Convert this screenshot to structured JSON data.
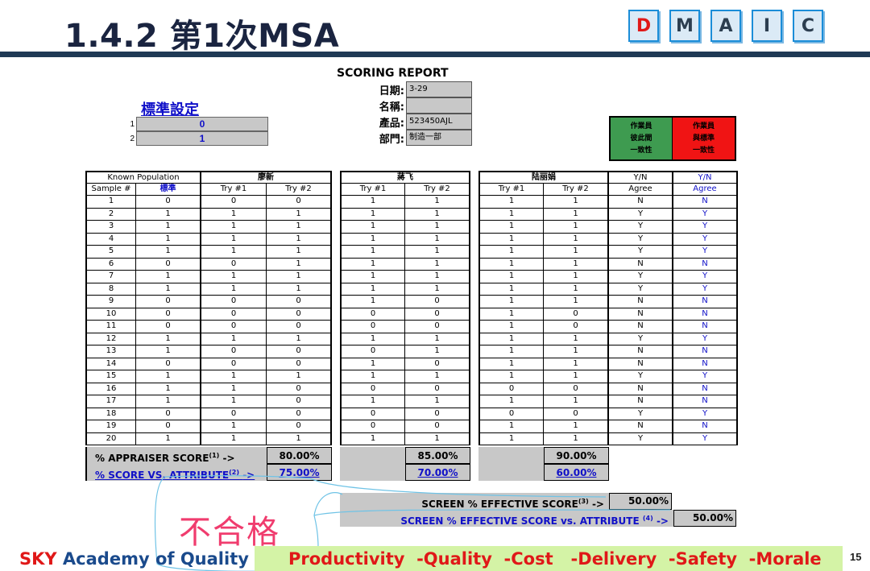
{
  "slide": {
    "title": "1.4.2 第1次MSA",
    "dmaic": [
      {
        "letter": "D",
        "active": true
      },
      {
        "letter": "M",
        "active": false
      },
      {
        "letter": "A",
        "active": false
      },
      {
        "letter": "I",
        "active": false
      },
      {
        "letter": "C",
        "active": false
      }
    ],
    "page_number": "15"
  },
  "report": {
    "title": "SCORING REPORT",
    "info": [
      {
        "label": "日期:",
        "value": "3-29"
      },
      {
        "label": "名稱:",
        "value": ""
      },
      {
        "label": "產品:",
        "value": "523450AJL"
      },
      {
        "label": "部門:",
        "value": "制造一部"
      }
    ]
  },
  "standard": {
    "heading": "標準設定",
    "rows": [
      {
        "index": "1",
        "value": "0"
      },
      {
        "index": "2",
        "value": "1"
      }
    ]
  },
  "legend": {
    "agree_lines": [
      "作業員",
      "彼此間",
      "一致性"
    ],
    "attr_lines": [
      "作業員",
      "與標準",
      "一致性"
    ],
    "agree_color": "#3e9b50",
    "attr_color": "#f01414"
  },
  "table": {
    "group_headers": [
      "Known Population",
      "廖新",
      "蔣飞",
      "陆丽娟",
      "Y/N",
      "Y/N"
    ],
    "sub_headers": [
      "Sample #",
      "標準",
      "Try #1",
      "Try #2",
      "Try #1",
      "Try #2",
      "Try #1",
      "Try #2",
      "Agree",
      "Agree"
    ],
    "rows": [
      [
        "1",
        "0",
        "0",
        "0",
        "1",
        "1",
        "1",
        "1",
        "N",
        "N"
      ],
      [
        "2",
        "1",
        "1",
        "1",
        "1",
        "1",
        "1",
        "1",
        "Y",
        "Y"
      ],
      [
        "3",
        "1",
        "1",
        "1",
        "1",
        "1",
        "1",
        "1",
        "Y",
        "Y"
      ],
      [
        "4",
        "1",
        "1",
        "1",
        "1",
        "1",
        "1",
        "1",
        "Y",
        "Y"
      ],
      [
        "5",
        "1",
        "1",
        "1",
        "1",
        "1",
        "1",
        "1",
        "Y",
        "Y"
      ],
      [
        "6",
        "0",
        "0",
        "1",
        "1",
        "1",
        "1",
        "1",
        "N",
        "N"
      ],
      [
        "7",
        "1",
        "1",
        "1",
        "1",
        "1",
        "1",
        "1",
        "Y",
        "Y"
      ],
      [
        "8",
        "1",
        "1",
        "1",
        "1",
        "1",
        "1",
        "1",
        "Y",
        "Y"
      ],
      [
        "9",
        "0",
        "0",
        "0",
        "1",
        "0",
        "1",
        "1",
        "N",
        "N"
      ],
      [
        "10",
        "0",
        "0",
        "0",
        "0",
        "0",
        "1",
        "0",
        "N",
        "N"
      ],
      [
        "11",
        "0",
        "0",
        "0",
        "0",
        "0",
        "1",
        "0",
        "N",
        "N"
      ],
      [
        "12",
        "1",
        "1",
        "1",
        "1",
        "1",
        "1",
        "1",
        "Y",
        "Y"
      ],
      [
        "13",
        "1",
        "0",
        "0",
        "0",
        "1",
        "1",
        "1",
        "N",
        "N"
      ],
      [
        "14",
        "0",
        "0",
        "0",
        "1",
        "0",
        "1",
        "1",
        "N",
        "N"
      ],
      [
        "15",
        "1",
        "1",
        "1",
        "1",
        "1",
        "1",
        "1",
        "Y",
        "Y"
      ],
      [
        "16",
        "1",
        "1",
        "0",
        "0",
        "0",
        "0",
        "0",
        "N",
        "N"
      ],
      [
        "17",
        "1",
        "1",
        "0",
        "1",
        "1",
        "1",
        "1",
        "N",
        "N"
      ],
      [
        "18",
        "0",
        "0",
        "0",
        "0",
        "0",
        "0",
        "0",
        "Y",
        "Y"
      ],
      [
        "19",
        "0",
        "1",
        "0",
        "0",
        "0",
        "1",
        "1",
        "N",
        "N"
      ],
      [
        "20",
        "1",
        "1",
        "1",
        "1",
        "1",
        "1",
        "1",
        "Y",
        "Y"
      ]
    ]
  },
  "scores": {
    "appraiser_label": "% APPRAISER SCORE",
    "appraiser_sup": "(1)",
    "appraiser_arrow": "->",
    "appraiser_values": [
      "80.00%",
      "85.00%",
      "90.00%"
    ],
    "attribute_label": "% SCORE VS. ATTRIBUTE",
    "attribute_sup": "(2)",
    "attribute_arrow": "->",
    "attribute_values": [
      "75.00%",
      "70.00%",
      "60.00%"
    ],
    "screen_label": "SCREEN % EFFECTIVE SCORE",
    "screen_sup": "(3)",
    "screen_arrow": "->",
    "screen_value": "50.00%",
    "screen_attr_label": "SCREEN % EFFECTIVE SCORE vs. ATTRIBUTE",
    "screen_attr_sup": "(4)",
    "screen_attr_arrow": "->",
    "screen_attr_value": "50.00%"
  },
  "stamp": {
    "text": "不合格",
    "color": "#f03c6e"
  },
  "footer": {
    "org_sky": "SKY",
    "org_rest": " Academy of Quality",
    "slogan": "Productivity  -Quality  -Cost   -Delivery  -Safety  -Morale"
  },
  "colors": {
    "title_rule": "#1f3a55",
    "highlight_blue": "#1010c8",
    "footer_bar": "#d4f3a6",
    "footer_text": "#e01818"
  }
}
